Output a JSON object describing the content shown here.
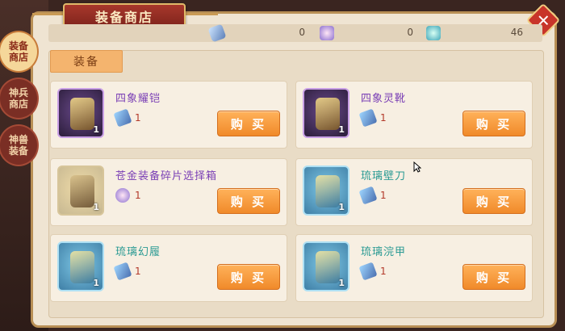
{
  "title": "装备商店",
  "currencies": [
    {
      "icon": "feather-currency-icon",
      "value": "0"
    },
    {
      "icon": "crystal-currency-icon",
      "value": "0"
    },
    {
      "icon": "jade-currency-icon",
      "value": "46"
    }
  ],
  "tab": {
    "label": "装备"
  },
  "side_tabs": [
    {
      "label_line1": "装备",
      "label_line2": "商店",
      "active": true
    },
    {
      "label_line1": "神兵",
      "label_line2": "商店",
      "active": false
    },
    {
      "label_line1": "神兽",
      "label_line2": "装备",
      "active": false
    }
  ],
  "items": [
    {
      "name": "四象耀铠",
      "count": "1",
      "cost": "1",
      "buy_label": "购 买"
    },
    {
      "name": "四象灵靴",
      "count": "1",
      "cost": "1",
      "buy_label": "购 买"
    },
    {
      "name": "苍金装备碎片选择箱",
      "count": "1",
      "cost": "1",
      "buy_label": "购 买"
    },
    {
      "name": "琉璃壁刀",
      "count": "1",
      "cost": "1",
      "buy_label": "购 买"
    },
    {
      "name": "琉璃幻履",
      "count": "1",
      "cost": "1",
      "buy_label": "购 买"
    },
    {
      "name": "琉璃浣甲",
      "count": "1",
      "cost": "1",
      "buy_label": "购 买"
    }
  ],
  "colors": {
    "accent_orange": "#f08a2a",
    "title_red": "#a8382c",
    "name_purple": "#6b3fa0",
    "name_teal": "#2a9a93",
    "cost_red": "#b33a2a"
  }
}
